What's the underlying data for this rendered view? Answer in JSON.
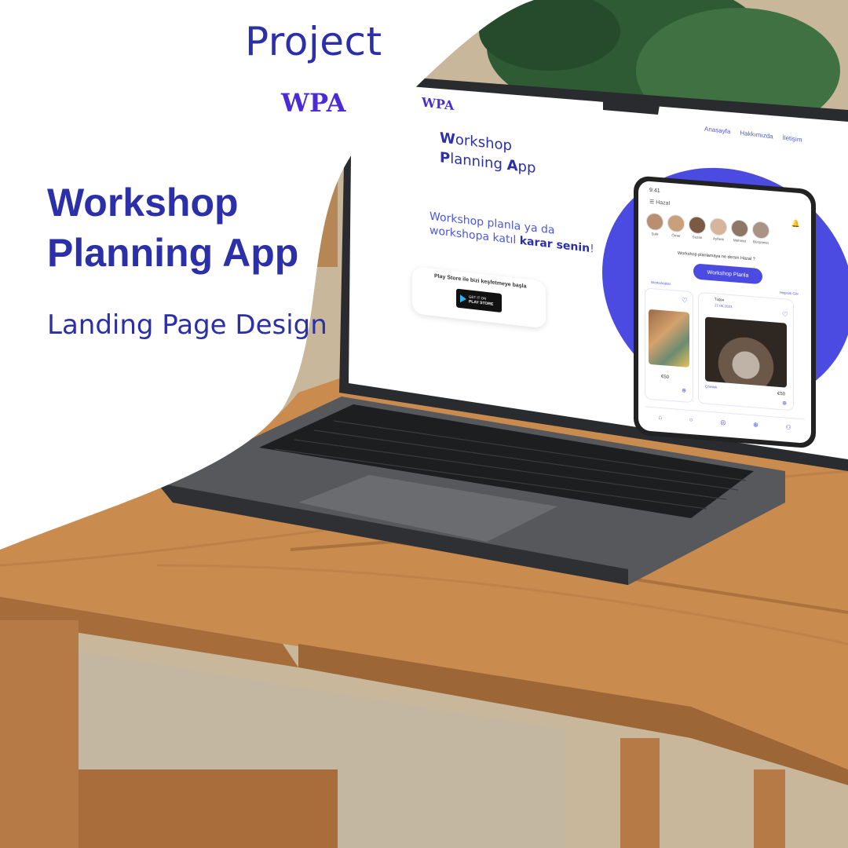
{
  "overlay": {
    "project_label": "Project",
    "logo": "WPA",
    "title": "Workshop Planning App",
    "subtitle": "Landing Page Design"
  },
  "screen": {
    "logo": "WPA",
    "nav": [
      "Anasayfa",
      "Hakkımızda",
      "İletişim"
    ],
    "hero_line1_initial": "W",
    "hero_line1_rest": "orkshop",
    "hero_line2_initial": "P",
    "hero_line2_rest": "lanning ",
    "hero_line2_initial2": "A",
    "hero_line2_rest2": "pp",
    "message_part1": "Workshop planla ya da workshopa katıl ",
    "message_bold": "karar senin",
    "message_end": "!",
    "store_text": "Play Store ile bizi keşfetmeye başla",
    "store_button_small": "GET IT ON",
    "store_button_big": "PLAY STORE"
  },
  "phone": {
    "time": "9:41",
    "greeting": "Hazal",
    "avatars": [
      "Şule",
      "Ömer",
      "Suzan",
      "Ayfane",
      "Mehmet",
      "Bünyamin"
    ],
    "question": "Workshop planlamaya ne dersin Hazal ?",
    "cta": "Workshop Planla",
    "section_label": "Workshoplar",
    "see_all": "Hepsini Gör",
    "card_user": "Tuğçe",
    "card_date": "27.05.2023",
    "card_location": "Çömlek",
    "price_left": "€50",
    "price_right": "€50"
  },
  "colors": {
    "brand": "#2b2fa8",
    "accent": "#4b4be2"
  }
}
